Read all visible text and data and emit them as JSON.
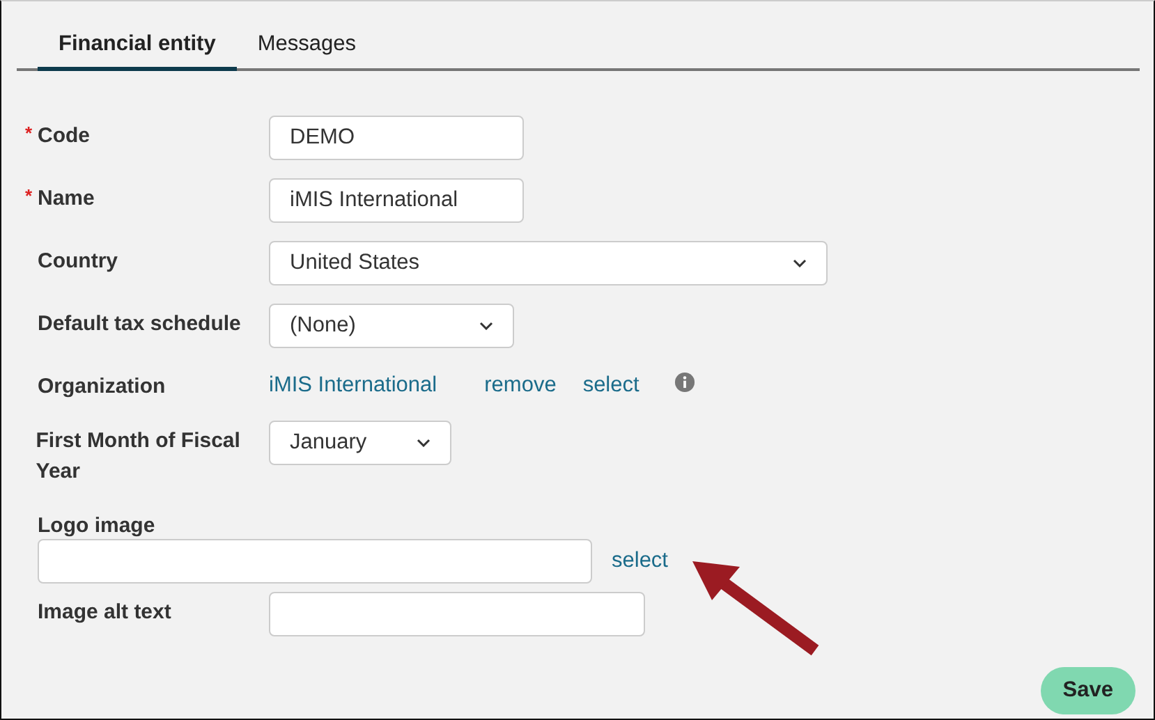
{
  "tabs": [
    {
      "label": "Financial entity",
      "selected": true
    },
    {
      "label": "Messages",
      "selected": false
    }
  ],
  "fields": [
    {
      "kind": "text",
      "required_mark": "*",
      "label": "Code",
      "value": "DEMO"
    },
    {
      "kind": "text",
      "required_mark": "*",
      "label": "Name",
      "value": "iMIS International"
    },
    {
      "kind": "select",
      "label": "Country",
      "value": "United States"
    },
    {
      "kind": "select",
      "label": "Default tax schedule",
      "value": "(None)"
    },
    {
      "kind": "links",
      "label": "Organization",
      "value": "iMIS International",
      "links": [
        "remove",
        "select"
      ]
    },
    {
      "kind": "select",
      "label": "First Month of Fiscal Year",
      "value": "January"
    },
    {
      "kind": "stacked",
      "label": "Logo image",
      "links": [
        "select"
      ]
    },
    {
      "kind": "text",
      "label": "Image alt text"
    }
  ],
  "save_button": "Save"
}
